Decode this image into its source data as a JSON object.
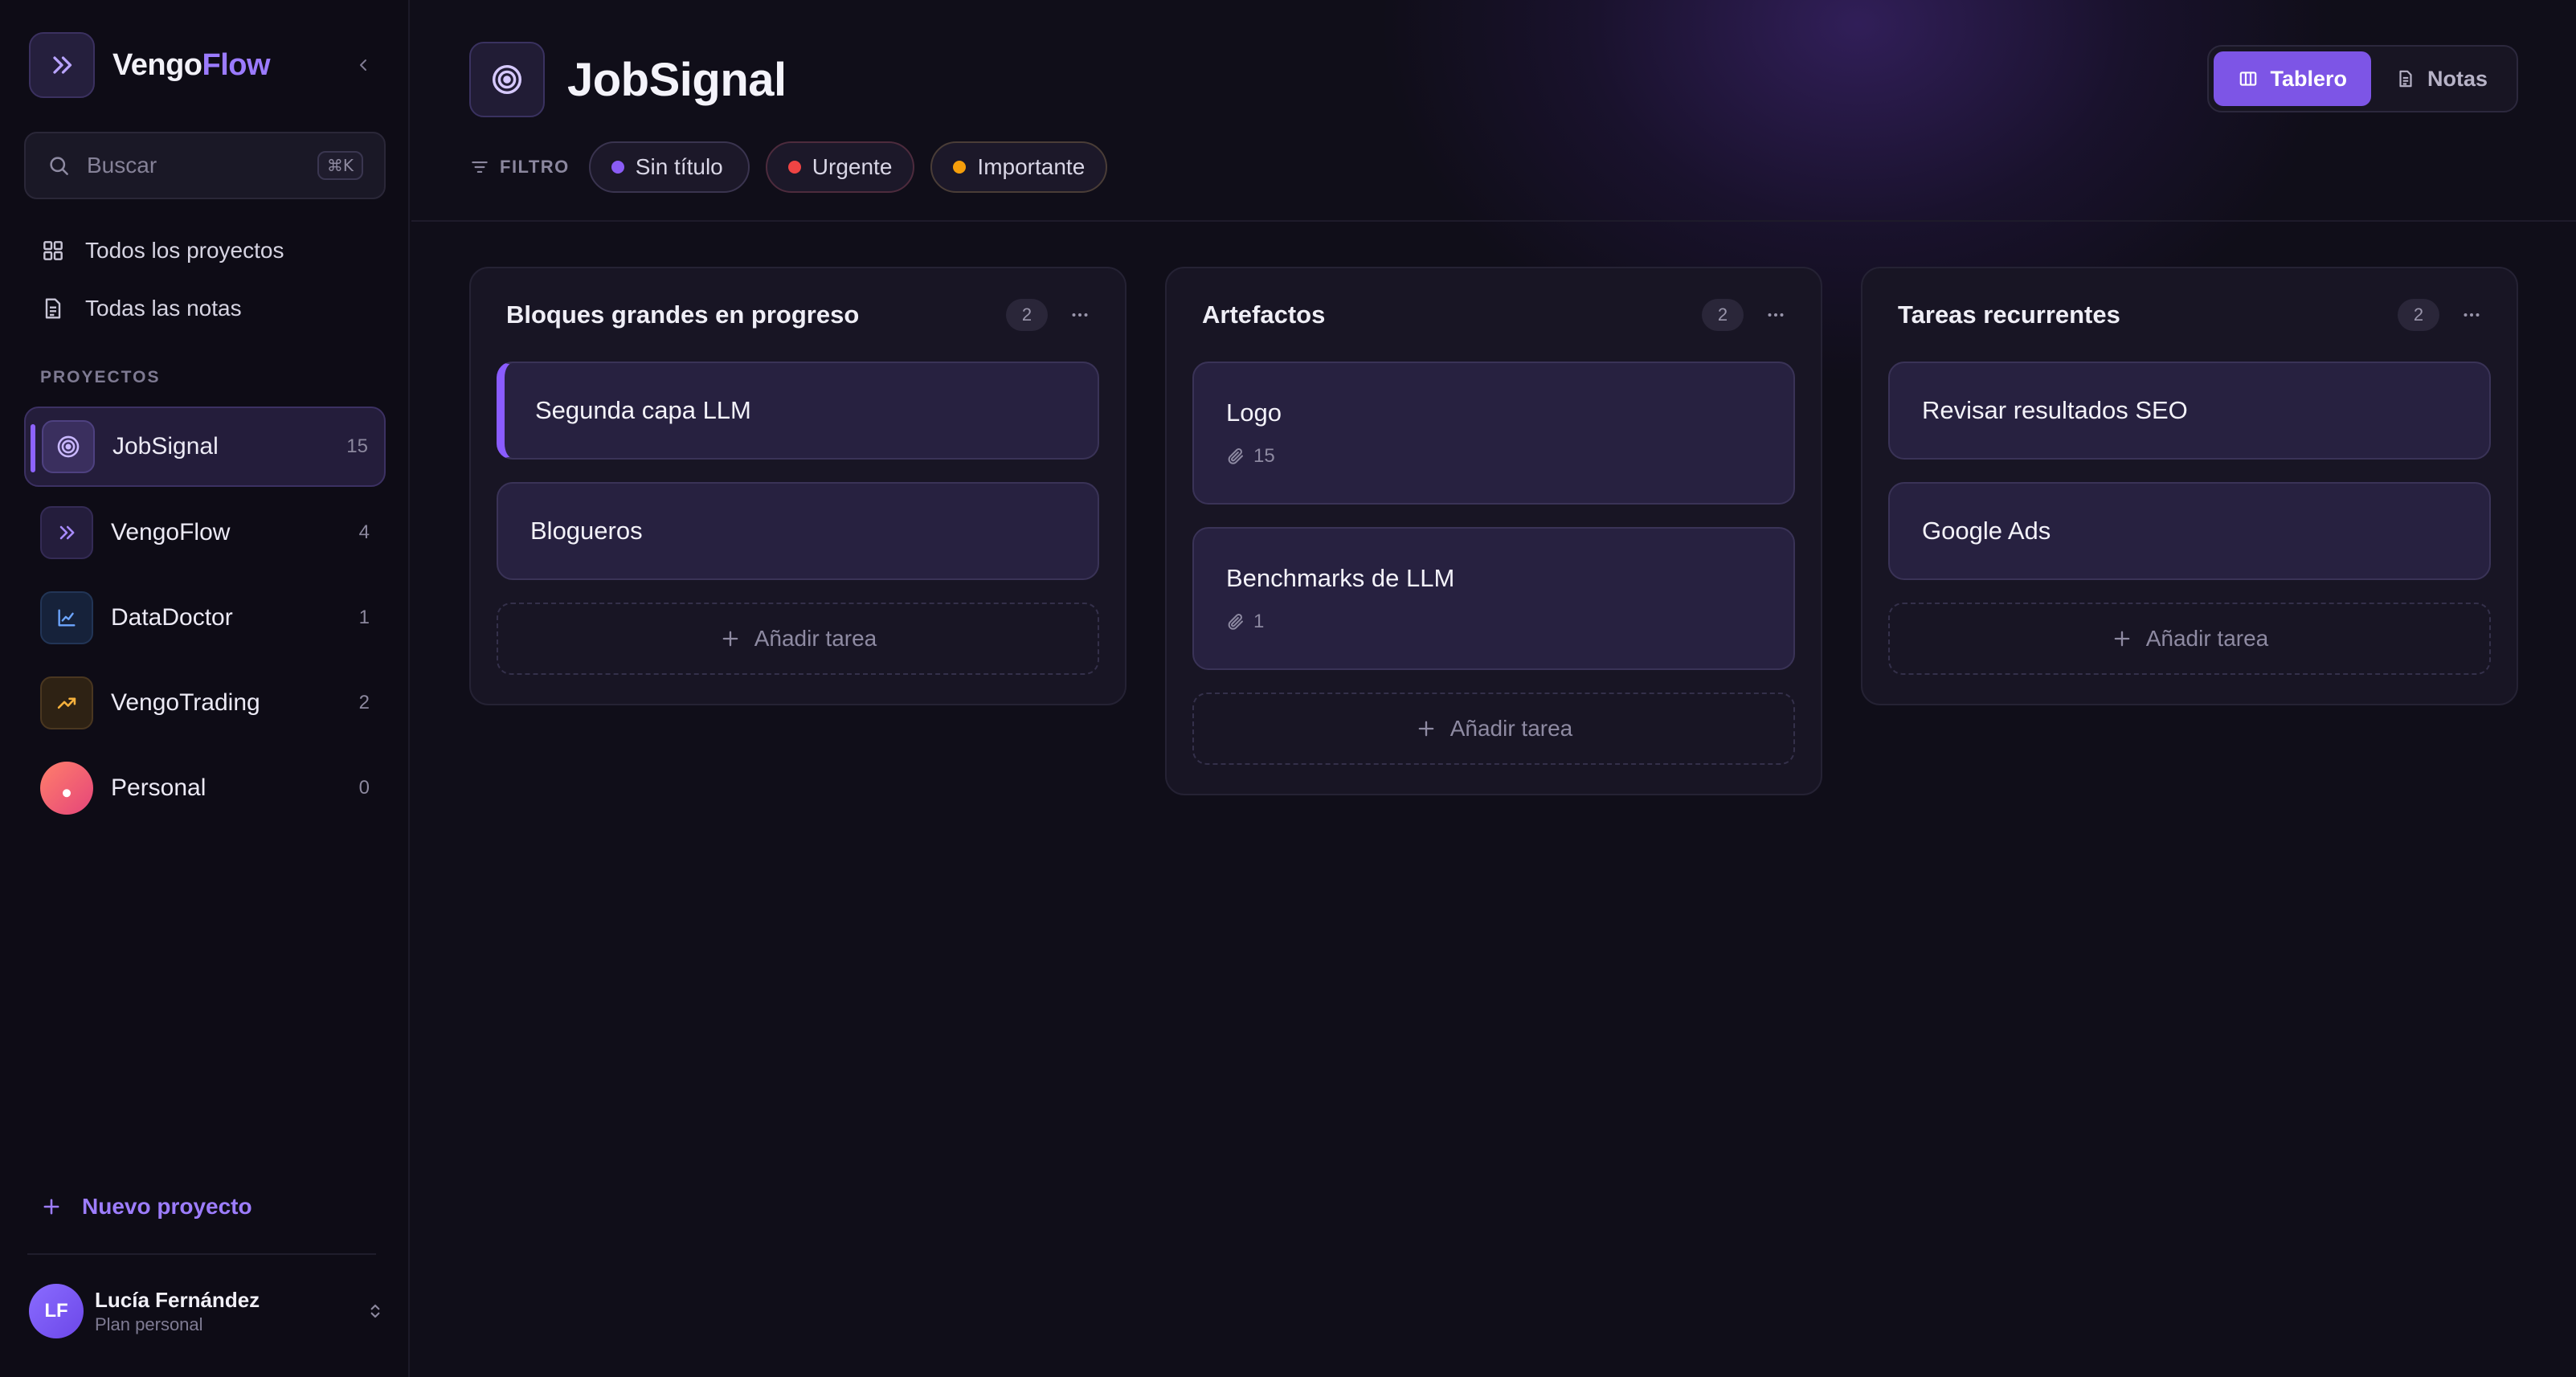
{
  "app": {
    "brand_primary": "Vengo",
    "brand_accent": "Flow",
    "accent_color": "#8d63ff"
  },
  "sidebar": {
    "search": {
      "placeholder": "Buscar",
      "shortcut": "⌘K"
    },
    "nav": [
      {
        "label": "Todos los proyectos",
        "icon": "grid-icon"
      },
      {
        "label": "Todas las notas",
        "icon": "document-icon"
      }
    ],
    "section_title": "PROYECTOS",
    "projects": [
      {
        "name": "JobSignal",
        "count": "15",
        "icon": "target-icon",
        "active": true
      },
      {
        "name": "VengoFlow",
        "count": "4",
        "icon": "chevrons-right-icon"
      },
      {
        "name": "DataDoctor",
        "count": "1",
        "icon": "line-chart-icon"
      },
      {
        "name": "VengoTrading",
        "count": "2",
        "icon": "trending-up-icon"
      },
      {
        "name": "Personal",
        "count": "0",
        "icon": "person-icon"
      }
    ],
    "new_project": "Nuevo proyecto",
    "user": {
      "initials": "LF",
      "name": "Lucía Fernández",
      "plan": "Plan personal"
    }
  },
  "header": {
    "project_title": "JobSignal",
    "filter_label": "FILTRO",
    "filters": [
      {
        "label": "Sin título",
        "color": "#8b5cf6"
      },
      {
        "label": "Urgente",
        "color": "#ef4444"
      },
      {
        "label": "Importante",
        "color": "#f59e0b"
      }
    ],
    "views": [
      {
        "label": "Tablero",
        "active": true
      },
      {
        "label": "Notas",
        "active": false
      }
    ]
  },
  "board": {
    "add_task_label": "Añadir tarea",
    "columns": [
      {
        "title": "Bloques grandes en progreso",
        "count": "2",
        "cards": [
          {
            "title": "Segunda capa LLM"
          },
          {
            "title": "Blogueros"
          }
        ]
      },
      {
        "title": "Artefactos",
        "count": "2",
        "cards": [
          {
            "title": "Logo",
            "attachments": "15"
          },
          {
            "title": "Benchmarks de LLM",
            "attachments": "1"
          }
        ]
      },
      {
        "title": "Tareas recurrentes",
        "count": "2",
        "cards": [
          {
            "title": "Revisar resultados SEO"
          },
          {
            "title": "Google Ads"
          }
        ]
      }
    ]
  }
}
